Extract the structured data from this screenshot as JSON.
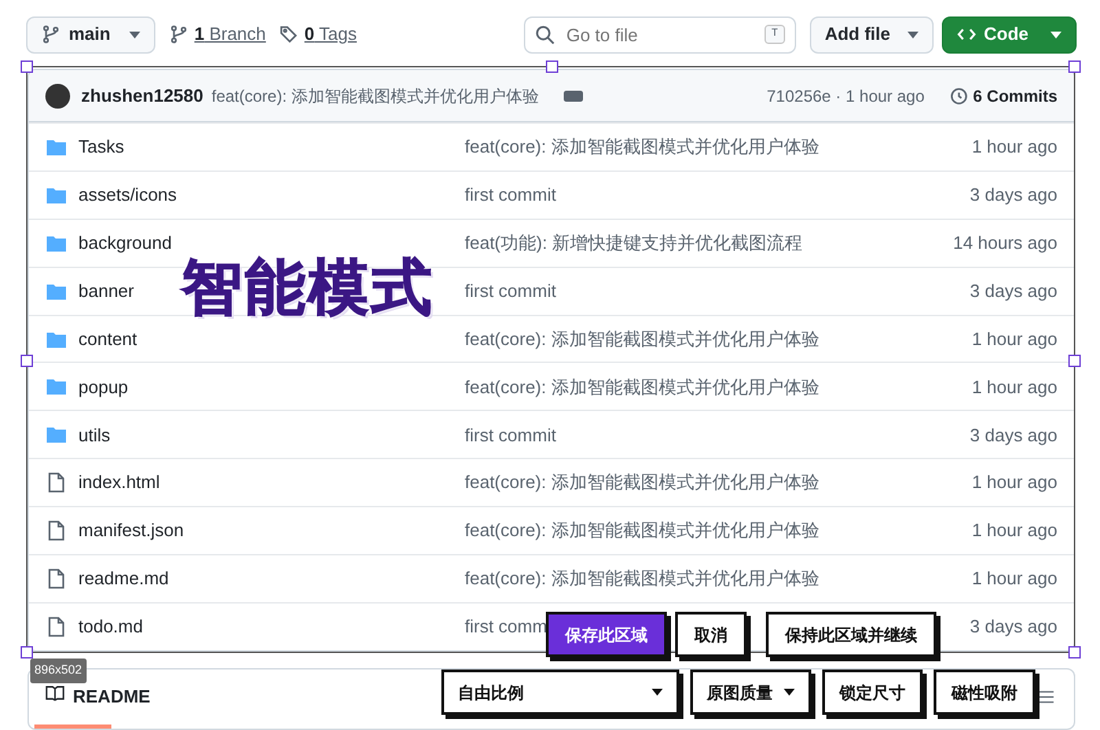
{
  "toolbar": {
    "branch": "main",
    "branch_count": "1",
    "branch_label": "Branch",
    "tag_count": "0",
    "tag_label": "Tags",
    "search": {
      "placeholder": "Go to file",
      "shortcut": "T"
    },
    "add_file": "Add file",
    "code": "Code"
  },
  "latest_commit": {
    "author": "zhushen12580",
    "message": "feat(core): 添加智能截图模式并优化用户体验",
    "hash_time": "710256e · 1 hour ago",
    "commits": "6 Commits"
  },
  "files": [
    {
      "kind": "folder",
      "name": "Tasks",
      "message": "feat(core): 添加智能截图模式并优化用户体验",
      "time": "1 hour ago"
    },
    {
      "kind": "folder",
      "name": "assets/icons",
      "message": "first commit",
      "time": "3 days ago"
    },
    {
      "kind": "folder",
      "name": "background",
      "message": "feat(功能): 新增快捷键支持并优化截图流程",
      "time": "14 hours ago"
    },
    {
      "kind": "folder",
      "name": "banner",
      "message": "first commit",
      "time": "3 days ago"
    },
    {
      "kind": "folder",
      "name": "content",
      "message": "feat(core): 添加智能截图模式并优化用户体验",
      "time": "1 hour ago"
    },
    {
      "kind": "folder",
      "name": "popup",
      "message": "feat(core): 添加智能截图模式并优化用户体验",
      "time": "1 hour ago"
    },
    {
      "kind": "folder",
      "name": "utils",
      "message": "first commit",
      "time": "3 days ago"
    },
    {
      "kind": "file",
      "name": "index.html",
      "message": "feat(core): 添加智能截图模式并优化用户体验",
      "time": "1 hour ago"
    },
    {
      "kind": "file",
      "name": "manifest.json",
      "message": "feat(core): 添加智能截图模式并优化用户体验",
      "time": "1 hour ago"
    },
    {
      "kind": "file",
      "name": "readme.md",
      "message": "feat(core): 添加智能截图模式并优化用户体验",
      "time": "1 hour ago"
    },
    {
      "kind": "file",
      "name": "todo.md",
      "message": "first comm",
      "time": "3 days ago"
    }
  ],
  "readme": {
    "label": "README"
  },
  "overlay": {
    "mode_label": "智能模式",
    "size": "896x502",
    "actions": [
      {
        "label": "保存此区域",
        "primary": true
      },
      {
        "label": "取消",
        "primary": false
      },
      {
        "label": "保持此区域并继续",
        "primary": false
      }
    ],
    "options": [
      {
        "kind": "select",
        "label": "自由比例"
      },
      {
        "kind": "select",
        "label": "原图质量"
      },
      {
        "kind": "button",
        "label": "锁定尺寸"
      },
      {
        "kind": "button",
        "label": "磁性吸附"
      }
    ]
  }
}
